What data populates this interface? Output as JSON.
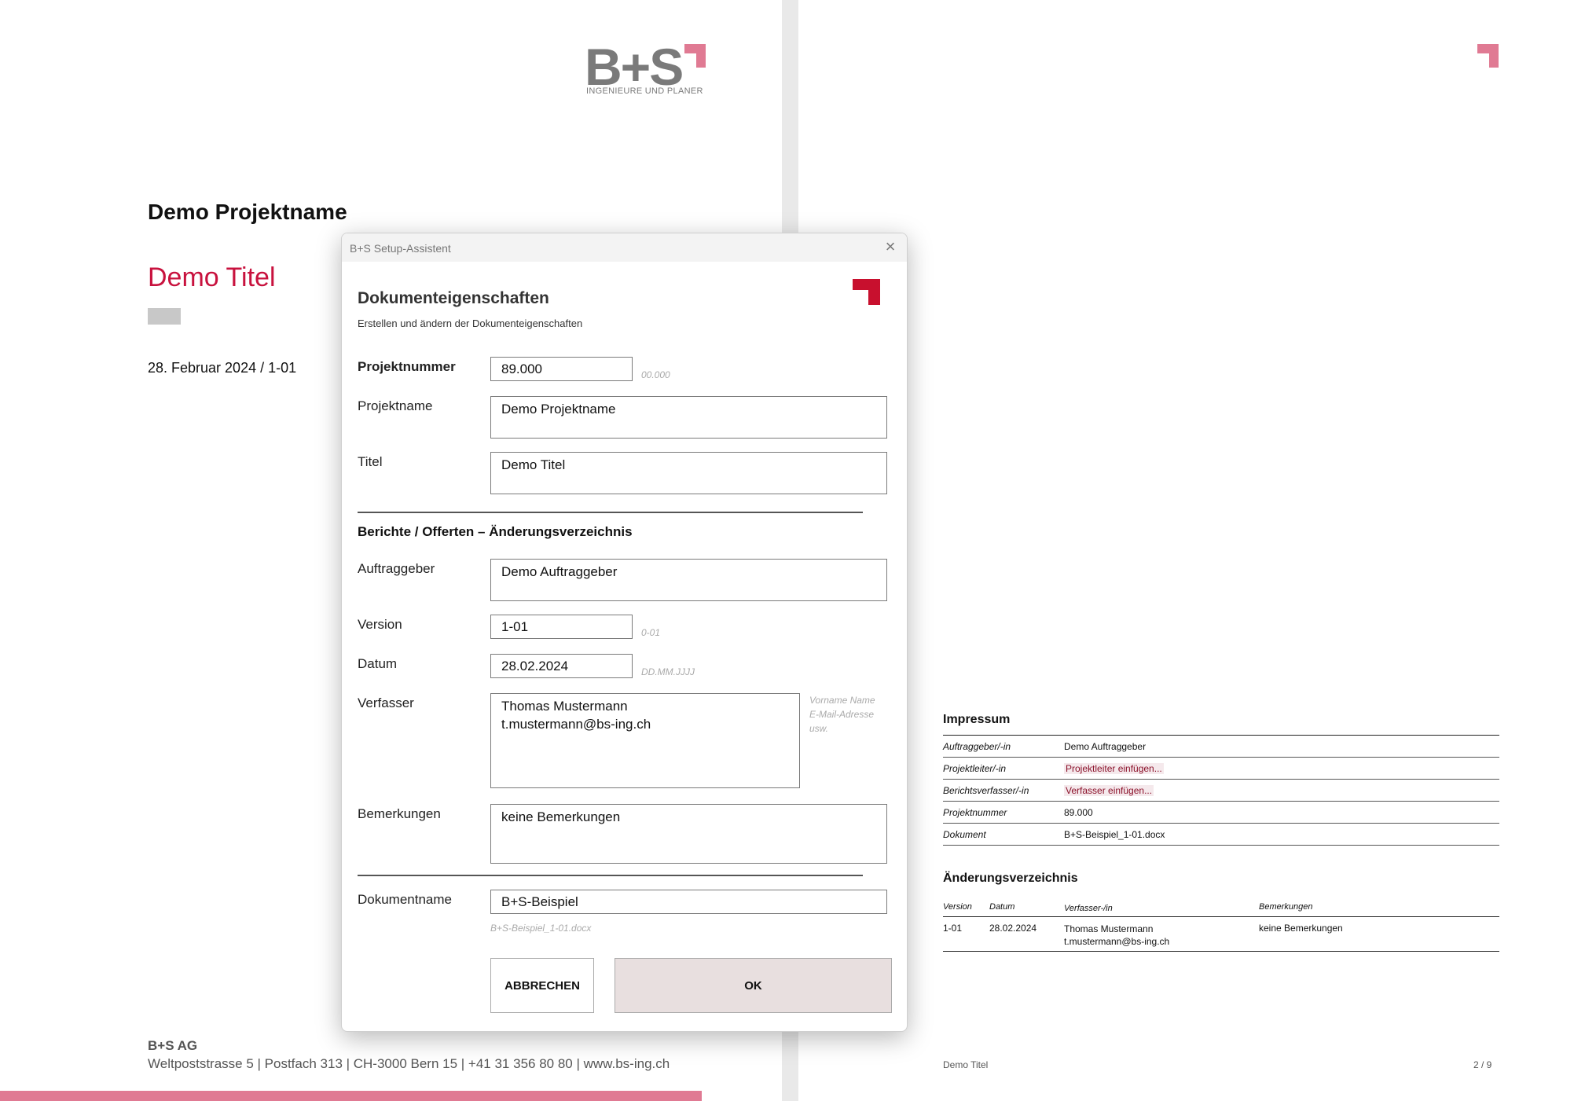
{
  "page1": {
    "logo_text": "B+S",
    "logo_subtitle": "INGENIEURE UND PLANER",
    "project_name": "Demo Projektname",
    "title": "Demo Titel",
    "date_version": "28. Februar 2024 / 1-01",
    "footer_company": "B+S AG",
    "footer_address": "Weltpoststrasse 5 | Postfach 313 | CH-3000 Bern 15 | +41 31 356 80 80 | www.bs-ing.ch"
  },
  "page2": {
    "impressum_title": "Impressum",
    "impressum_rows": [
      {
        "key": "Auftraggeber/-in",
        "value": "Demo Auftraggeber"
      },
      {
        "key": "Projektleiter/-in",
        "value": "Projektleiter einfügen..."
      },
      {
        "key": "Berichtsverfasser/-in",
        "value": "Verfasser einfügen..."
      },
      {
        "key": "Projektnummer",
        "value": "89.000"
      },
      {
        "key": "Dokument",
        "value": "B+S-Beispiel_1-01.docx"
      }
    ],
    "aenderung_title": "Änderungsverzeichnis",
    "aenderung_headers": [
      "Version",
      "Datum",
      "Verfasser-/in",
      "Bemerkungen"
    ],
    "aenderung_row": {
      "version": "1-01",
      "datum": "28.02.2024",
      "verfasser": "Thomas Mustermann\nt.mustermann@bs-ing.ch",
      "bemerkungen": "keine Bemerkungen"
    },
    "footer_title": "Demo Titel",
    "page_number": "2 / 9"
  },
  "dialog": {
    "window_title": "B+S Setup-Assistent",
    "close_symbol": "×",
    "heading": "Dokumenteigenschaften",
    "subheading": "Erstellen und ändern der Dokumenteigenschaften",
    "section_title": "Berichte / Offerten  –  Änderungsverzeichnis",
    "fields": {
      "projektnummer": {
        "label": "Projektnummer",
        "value": "89.000",
        "hint": "00.000"
      },
      "projektname": {
        "label": "Projektname",
        "value": "Demo Projektname"
      },
      "titel": {
        "label": "Titel",
        "value": "Demo Titel"
      },
      "auftraggeber": {
        "label": "Auftraggeber",
        "value": "Demo Auftraggeber"
      },
      "version": {
        "label": "Version",
        "value": "1-01",
        "hint": "0-01"
      },
      "datum": {
        "label": "Datum",
        "value": "28.02.2024",
        "hint": "DD.MM.JJJJ"
      },
      "verfasser": {
        "label": "Verfasser",
        "value": "Thomas Mustermann\nt.mustermann@bs-ing.ch",
        "hint": "Vorname Name\nE-Mail-Adresse\nusw."
      },
      "bemerkungen": {
        "label": "Bemerkungen",
        "value": "keine Bemerkungen"
      },
      "dokumentname": {
        "label": "Dokumentname",
        "value": "B+S-Beispiel",
        "hint": "B+S-Beispiel_1-01.docx"
      }
    },
    "buttons": {
      "cancel": "ABBRECHEN",
      "ok": "OK"
    },
    "colors": {
      "brand_red": "#c8102e",
      "ok_bg": "#e8dfdf"
    }
  },
  "colors": {
    "accent_pink": "#e07a93",
    "title_red": "#c8123e"
  }
}
